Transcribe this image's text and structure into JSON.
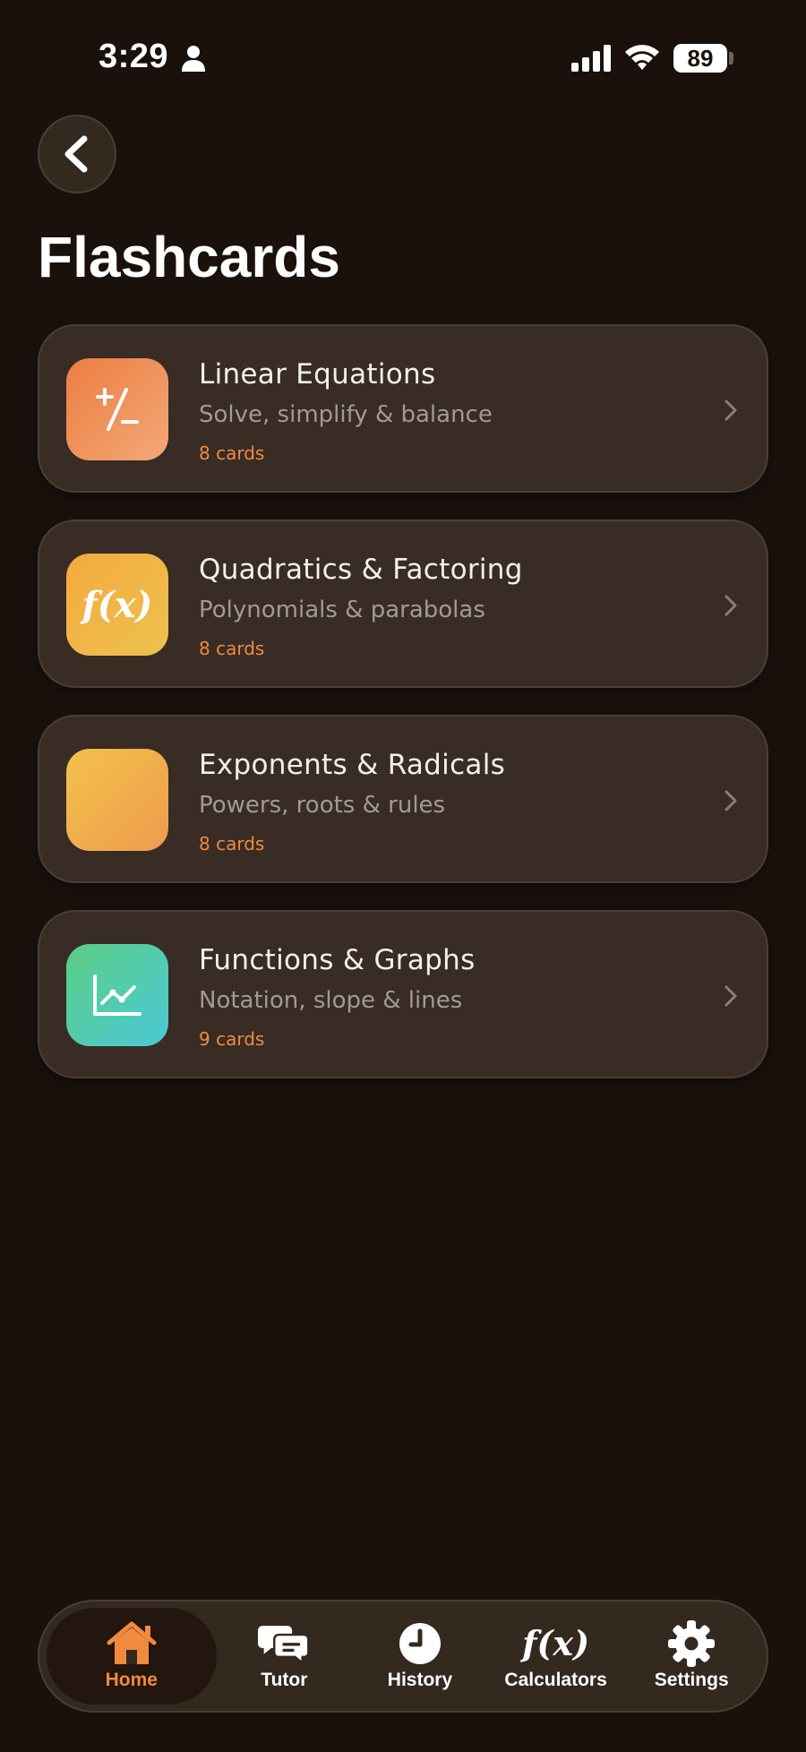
{
  "status_bar": {
    "time": "3:29",
    "battery_level": "89",
    "icons": [
      "person-icon",
      "signal-icon",
      "wifi-icon",
      "battery-icon"
    ]
  },
  "header": {
    "back_icon": "chevron-left-icon",
    "title": "Flashcards"
  },
  "decks": [
    {
      "title": "Linear Equations",
      "subtitle": "Solve, simplify & balance",
      "count": "8 cards",
      "icon": "plus-minus-icon",
      "gradient": [
        "#ec7d42",
        "#f3a877"
      ]
    },
    {
      "title": "Quadratics & Factoring",
      "subtitle": "Polynomials & parabolas",
      "count": "8 cards",
      "icon": "function-icon",
      "icon_text": "f(x)",
      "gradient": [
        "#f4a93e",
        "#edc24f"
      ]
    },
    {
      "title": "Exponents & Radicals",
      "subtitle": "Powers, roots & rules",
      "count": "8 cards",
      "icon": "exponent-icon",
      "gradient": [
        "#f3c14c",
        "#ee9b4d"
      ]
    },
    {
      "title": "Functions & Graphs",
      "subtitle": "Notation, slope & lines",
      "count": "9 cards",
      "icon": "line-chart-icon",
      "gradient": [
        "#5bcf84",
        "#4bc8d8"
      ]
    }
  ],
  "tab_bar": {
    "active": "Home",
    "items": [
      {
        "label": "Home",
        "icon": "home-icon"
      },
      {
        "label": "Tutor",
        "icon": "chat-icon"
      },
      {
        "label": "History",
        "icon": "clock-icon"
      },
      {
        "label": "Calculators",
        "icon": "function-icon",
        "icon_text": "f(x)"
      },
      {
        "label": "Settings",
        "icon": "gear-icon"
      }
    ]
  },
  "colors": {
    "background": "#1a110d",
    "card": "#382c24",
    "accent": "#f08a40",
    "subtitle": "#a39a93"
  }
}
